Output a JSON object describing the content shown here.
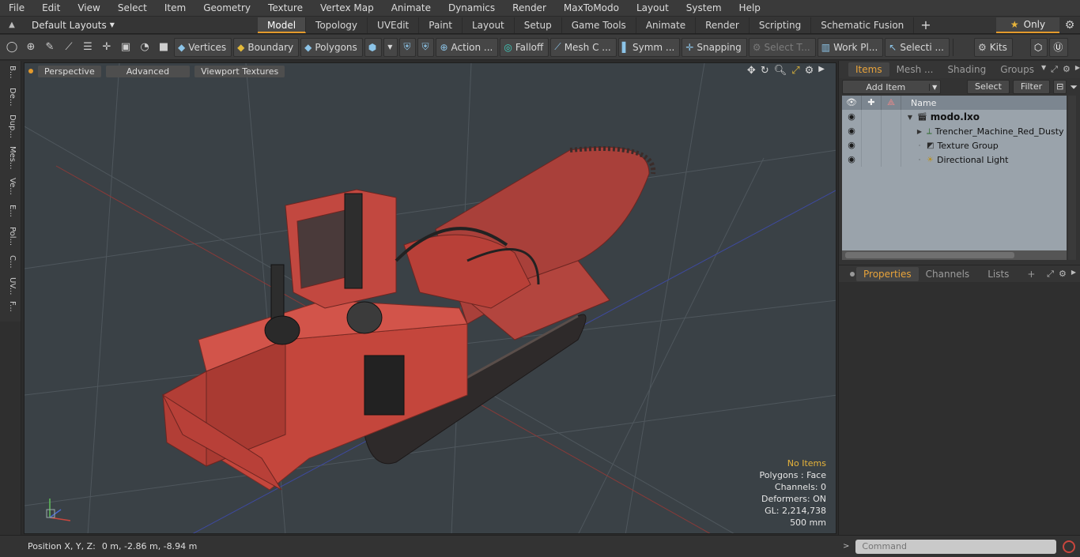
{
  "menubar": [
    "File",
    "Edit",
    "View",
    "Select",
    "Item",
    "Geometry",
    "Texture",
    "Vertex Map",
    "Animate",
    "Dynamics",
    "Render",
    "MaxToModo",
    "Layout",
    "System",
    "Help"
  ],
  "tabbar": {
    "layout_label": "Default Layouts",
    "tabs": [
      "Model",
      "Topology",
      "UVEdit",
      "Paint",
      "Layout",
      "Setup",
      "Game Tools",
      "Animate",
      "Render",
      "Scripting",
      "Schematic Fusion"
    ],
    "active_tab": "Model",
    "only_label": "Only"
  },
  "toolbar": {
    "vertices": "Vertices",
    "boundary": "Boundary",
    "polygons": "Polygons",
    "action": "Action ...",
    "falloff": "Falloff",
    "mesh": "Mesh C ...",
    "symm": "Symm ...",
    "snapping": "Snapping",
    "select_t": "Select T...",
    "workpl": "Work Pl...",
    "selecti": "Selecti ...",
    "kits": "Kits"
  },
  "leftstrip": [
    "B...",
    "De...",
    "Dup...",
    "Mes...",
    "Ve...",
    "E...",
    "Pol...",
    "C...",
    "UV...",
    "F..."
  ],
  "viewport": {
    "perspective": "Perspective",
    "advanced": "Advanced",
    "viewport_textures": "Viewport Textures",
    "stats": {
      "no_items": "No Items",
      "polygons": "Polygons : Face",
      "channels": "Channels: 0",
      "deformers": "Deformers: ON",
      "gl": "GL: 2,214,738",
      "scale": "500 mm"
    }
  },
  "status": {
    "label": "Position X, Y, Z:",
    "value": "0 m, -2.86 m, -8.94 m"
  },
  "items_panel": {
    "tabs": [
      "Items",
      "Mesh ...",
      "Shading",
      "Groups"
    ],
    "active_tab": "Items",
    "add_item": "Add Item",
    "select": "Select",
    "filter": "Filter",
    "name_header": "Name",
    "rows": [
      {
        "name": "modo.lxo",
        "bold": true,
        "icon": "scene-icon"
      },
      {
        "name": "Trencher_Machine_Red_Dusty",
        "bold": false,
        "icon": "mesh-icon"
      },
      {
        "name": "Texture Group",
        "bold": false,
        "icon": "texture-group-icon"
      },
      {
        "name": "Directional Light",
        "bold": false,
        "icon": "light-icon"
      }
    ]
  },
  "props_panel": {
    "tabs": [
      "Properties",
      "Channels",
      "Lists"
    ],
    "active_tab": "Properties"
  },
  "command": {
    "placeholder": "Command"
  },
  "colors": {
    "accent": "#e39a2c",
    "machine_red": "#c4463c",
    "viewport_bg": "#3a4146"
  }
}
